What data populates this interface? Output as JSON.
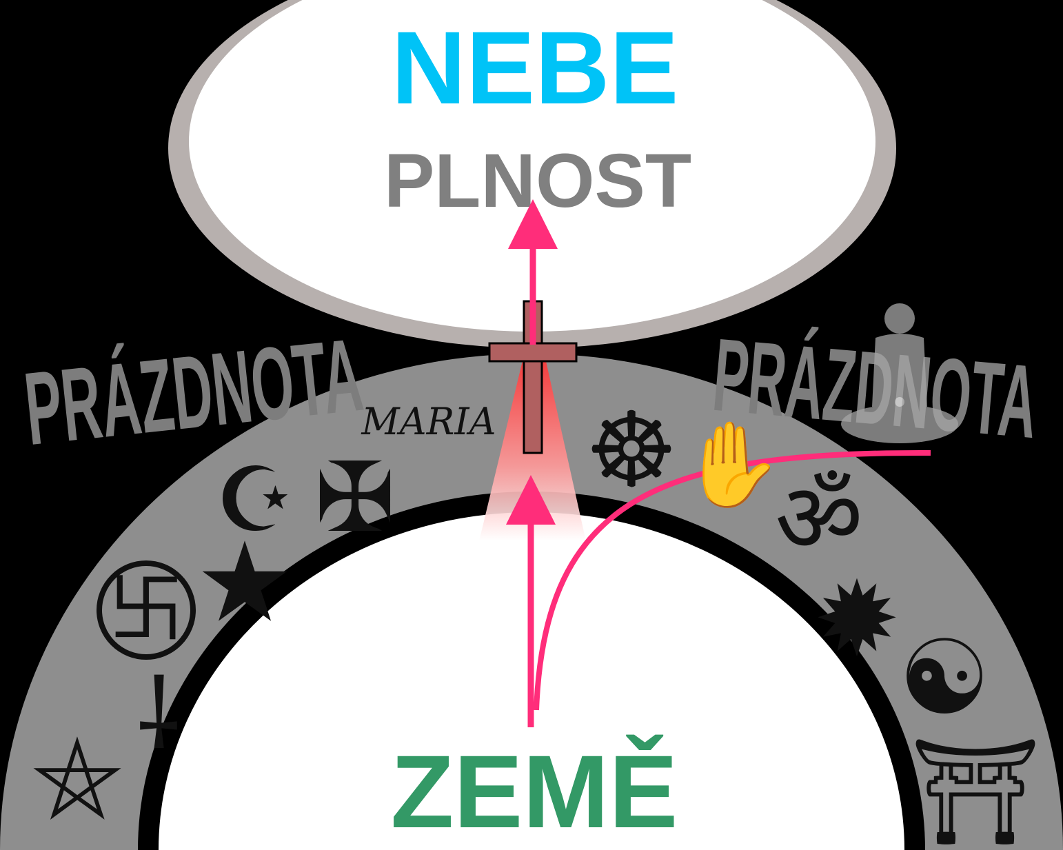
{
  "labels": {
    "heaven": "NEBE",
    "fullness": "PLNOST",
    "earth": "ZEMĚ",
    "void_left": "PRÁZDNOTA",
    "void_right": "PRÁZDNOTA"
  },
  "ring_symbols_left": [
    {
      "name": "maria-monogram-icon",
      "glyph": "MARIA"
    },
    {
      "name": "crescent-star-icon",
      "glyph": "☪"
    },
    {
      "name": "maltese-cross-icon",
      "glyph": "✠"
    },
    {
      "name": "swastika-circle-icon",
      "glyph": "卐"
    },
    {
      "name": "black-star-icon",
      "glyph": "★"
    },
    {
      "name": "inverted-cross-icon",
      "glyph": "⸸"
    },
    {
      "name": "pentagram-icon",
      "glyph": "⛤"
    }
  ],
  "ring_symbols_right": [
    {
      "name": "dharma-wheel-icon",
      "glyph": "☸"
    },
    {
      "name": "jain-hand-icon",
      "glyph": "✋"
    },
    {
      "name": "om-icon",
      "glyph": "ॐ"
    },
    {
      "name": "nine-point-star-icon",
      "glyph": "✹"
    },
    {
      "name": "yin-yang-icon",
      "glyph": "☯"
    },
    {
      "name": "torii-gate-icon",
      "glyph": "⛩"
    }
  ],
  "colors": {
    "background": "#000000",
    "heaven_text": "#00c3f7",
    "fullness_text": "#808080",
    "earth_text": "#339966",
    "void_text": "#7d7d7d",
    "ring": "#8e8e8e",
    "arrow": "#ff2d7a",
    "cross": "#b06060"
  }
}
